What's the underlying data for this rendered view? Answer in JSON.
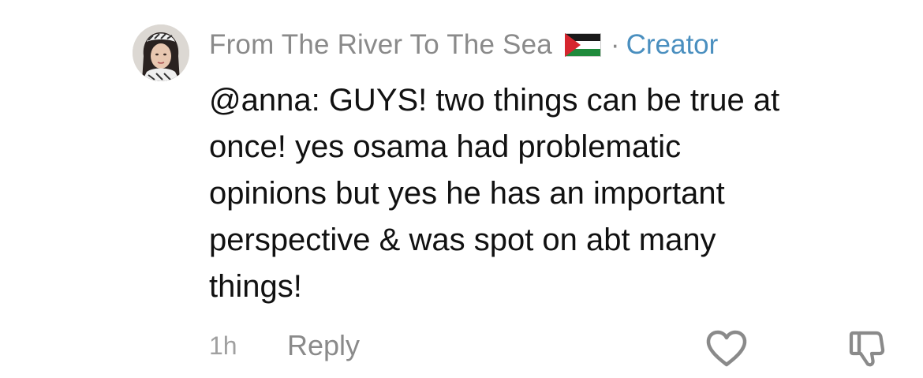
{
  "comment": {
    "author": "From The River To The Sea",
    "separator": "·",
    "badge": "Creator",
    "lines": [
      "@anna: GUYS! two things can be true at",
      "once! yes osama had problematic",
      "opinions but yes he has an important",
      "perspective & was spot on abt many",
      "things!"
    ],
    "time": "1h",
    "reply_label": "Reply"
  },
  "icons": {
    "avatar": "avatar-photo",
    "flag": "palestine-flag-icon",
    "like": "heart-outline-icon",
    "dislike": "thumbs-down-outline-icon"
  },
  "colors": {
    "author": "#8a8a8a",
    "badge": "#4a8fbf",
    "text": "#111111",
    "muted": "#a0a0a0"
  }
}
